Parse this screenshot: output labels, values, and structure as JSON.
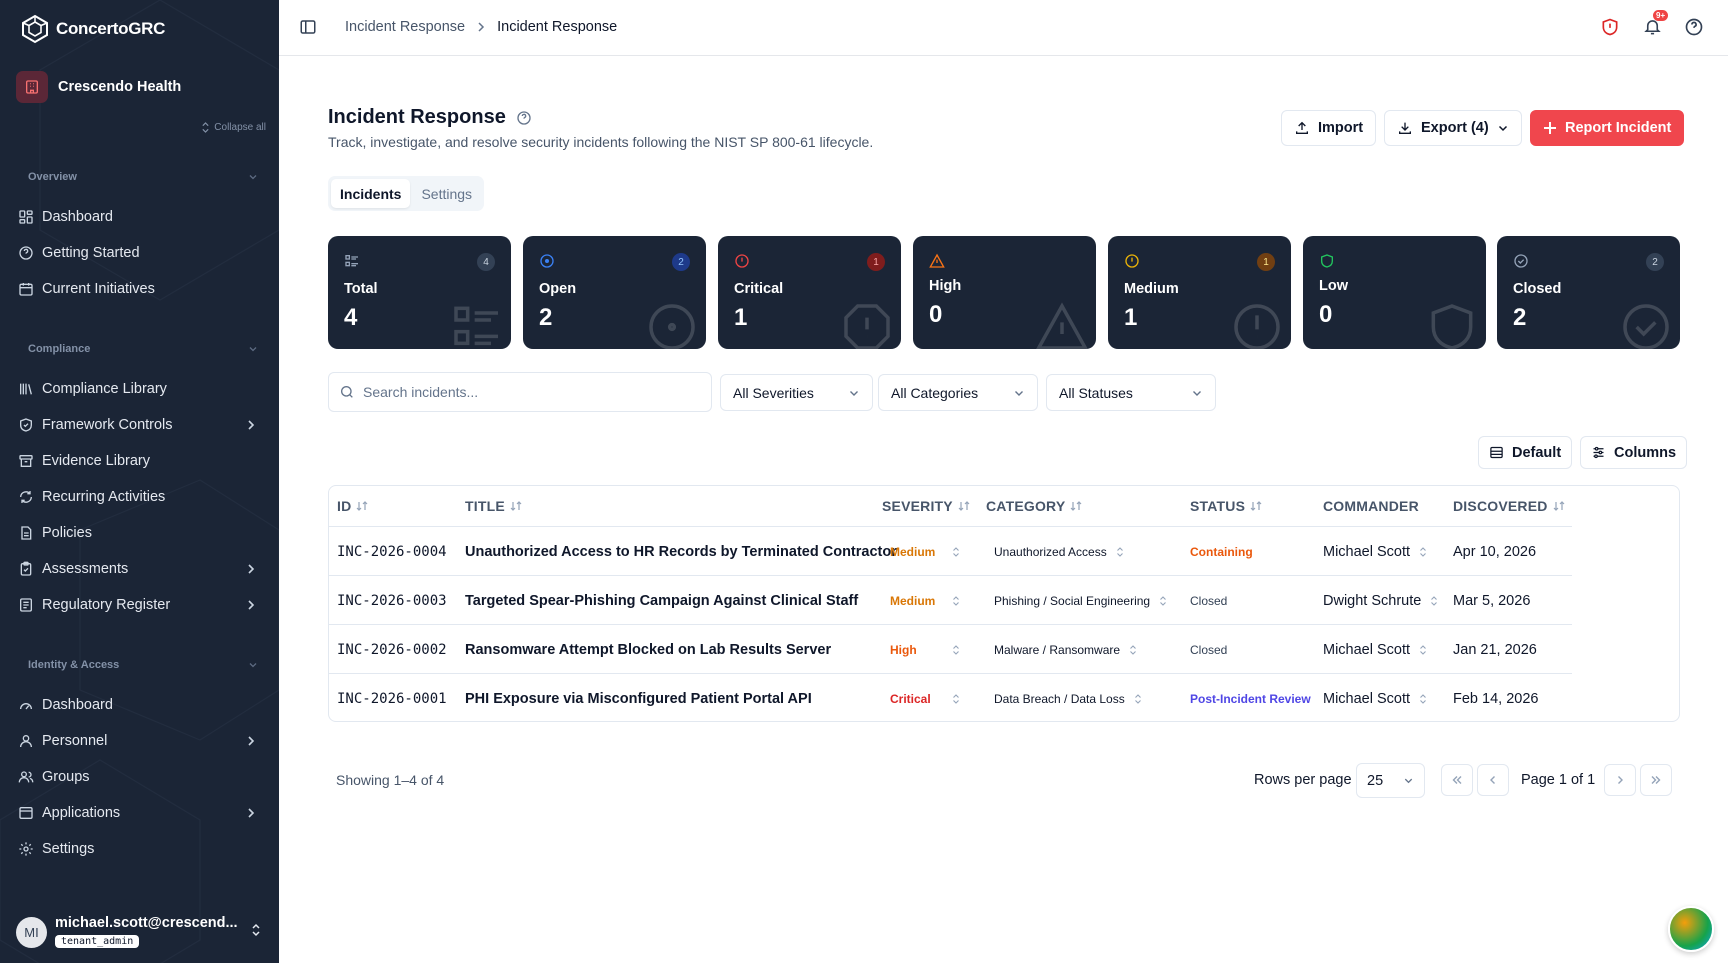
{
  "app": {
    "brand": "ConcertoGRC",
    "tenant": "Crescendo Health",
    "collapse_all": "Collapse all"
  },
  "sidebar": {
    "sections": [
      {
        "title": "Overview",
        "items": [
          {
            "label": "Dashboard",
            "icon": "dashboard-icon"
          },
          {
            "label": "Getting Started",
            "icon": "help-circle-icon"
          },
          {
            "label": "Current Initiatives",
            "icon": "calendar-icon"
          }
        ]
      },
      {
        "title": "Compliance",
        "items": [
          {
            "label": "Compliance Library",
            "icon": "library-icon"
          },
          {
            "label": "Framework Controls",
            "icon": "shield-check-icon",
            "expandable": true
          },
          {
            "label": "Evidence Library",
            "icon": "archive-icon"
          },
          {
            "label": "Recurring Activities",
            "icon": "refresh-icon"
          },
          {
            "label": "Policies",
            "icon": "file-text-icon"
          },
          {
            "label": "Assessments",
            "icon": "clipboard-check-icon",
            "expandable": true
          },
          {
            "label": "Regulatory Register",
            "icon": "register-icon",
            "expandable": true
          }
        ]
      },
      {
        "title": "Identity & Access",
        "items": [
          {
            "label": "Dashboard",
            "icon": "dashboard-icon"
          },
          {
            "label": "Personnel",
            "icon": "user-icon",
            "expandable": true
          },
          {
            "label": "Groups",
            "icon": "users-icon"
          },
          {
            "label": "Applications",
            "icon": "app-window-icon",
            "expandable": true
          },
          {
            "label": "Settings",
            "icon": "gear-icon"
          }
        ]
      }
    ],
    "user": {
      "initials": "MI",
      "email": "michael.scott@crescend...",
      "role": "tenant_admin"
    }
  },
  "topbar": {
    "breadcrumb": [
      "Incident Response",
      "Incident Response"
    ],
    "notification_badge": "9+"
  },
  "header": {
    "title": "Incident Response",
    "subtitle": "Track, investigate, and resolve security incidents following the NIST SP 800-61 lifecycle.",
    "import_label": "Import",
    "export_label": "Export (4)",
    "report_label": "Report Incident"
  },
  "tabs": [
    "Incidents",
    "Settings"
  ],
  "stats": [
    {
      "label": "Total",
      "value": "4",
      "count": "4",
      "color": "#94a3b8"
    },
    {
      "label": "Open",
      "value": "2",
      "count": "2",
      "color": "#3b82f6"
    },
    {
      "label": "Critical",
      "value": "1",
      "count": "1",
      "color": "#ef4444"
    },
    {
      "label": "High",
      "value": "0",
      "count": "",
      "color": "#f97316"
    },
    {
      "label": "Medium",
      "value": "1",
      "count": "1",
      "color": "#eab308"
    },
    {
      "label": "Low",
      "value": "0",
      "count": "",
      "color": "#22c55e"
    },
    {
      "label": "Closed",
      "value": "2",
      "count": "2",
      "color": "#94a3b8"
    }
  ],
  "filters": {
    "search_placeholder": "Search incidents...",
    "severity": "All Severities",
    "category": "All Categories",
    "status": "All Statuses"
  },
  "view": {
    "default_label": "Default",
    "columns_label": "Columns"
  },
  "table": {
    "headers": [
      "ID",
      "TITLE",
      "SEVERITY",
      "CATEGORY",
      "STATUS",
      "COMMANDER",
      "DISCOVERED"
    ],
    "rows": [
      {
        "id": "INC-2026-0004",
        "title": "Unauthorized Access to HR Records by Terminated Contractor",
        "severity": "Medium",
        "category": "Unauthorized Access",
        "status": "Containing",
        "commander": "Michael Scott",
        "discovered": "Apr 10, 2026"
      },
      {
        "id": "INC-2026-0003",
        "title": "Targeted Spear-Phishing Campaign Against Clinical Staff",
        "severity": "Medium",
        "category": "Phishing / Social Engineering",
        "status": "Closed",
        "commander": "Dwight Schrute",
        "discovered": "Mar 5, 2026"
      },
      {
        "id": "INC-2026-0002",
        "title": "Ransomware Attempt Blocked on Lab Results Server",
        "severity": "High",
        "category": "Malware / Ransomware",
        "status": "Closed",
        "commander": "Michael Scott",
        "discovered": "Jan 21, 2026"
      },
      {
        "id": "INC-2026-0001",
        "title": "PHI Exposure via Misconfigured Patient Portal API",
        "severity": "Critical",
        "category": "Data Breach / Data Loss",
        "status": "Post-Incident Review",
        "commander": "Michael Scott",
        "discovered": "Feb 14, 2026"
      }
    ],
    "colors": {
      "Medium": "#d97706",
      "High": "#ea580c",
      "Critical": "#dc2626",
      "Containing": "#ea580c",
      "Closed": "#334155",
      "Post-Incident Review": "#4f46e5"
    }
  },
  "footer": {
    "showing": "Showing 1–4 of 4",
    "rows_per_page_label": "Rows per page",
    "rows_per_page": "25",
    "page": "Page 1 of 1"
  }
}
